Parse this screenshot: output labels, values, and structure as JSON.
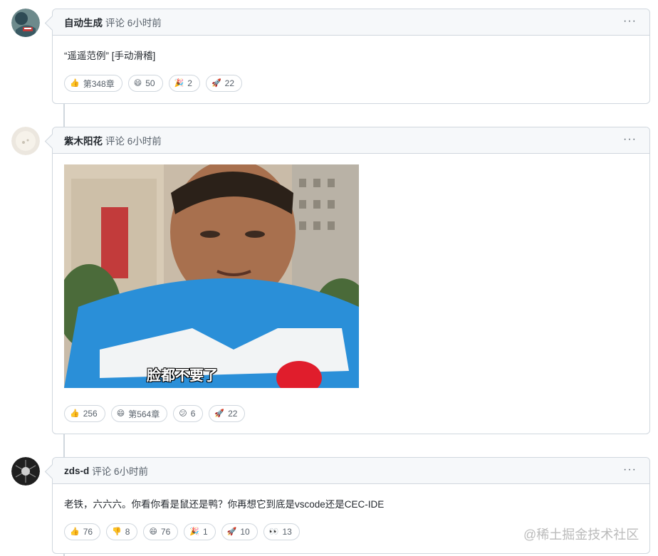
{
  "comments": [
    {
      "author": "自动生成",
      "meta": "评论 6小时前",
      "more": "···",
      "text": "“遥遥范例” [手动滑稽]",
      "reactions": [
        {
          "emoji": "👍",
          "count": "第348章"
        },
        {
          "emoji": "😄",
          "count": "50"
        },
        {
          "emoji": "🎉",
          "count": "2"
        },
        {
          "emoji": "🚀",
          "count": "22"
        }
      ]
    },
    {
      "author": "紫木阳花",
      "meta": "评论 6小时前",
      "more": "···",
      "image_caption": "脸都不要了",
      "reactions": [
        {
          "emoji": "👍",
          "count": "256"
        },
        {
          "emoji": "😄",
          "count": "第564章"
        },
        {
          "emoji": "😕",
          "count": "6"
        },
        {
          "emoji": "🚀",
          "count": "22"
        }
      ]
    },
    {
      "author": "zds-d",
      "meta": "评论 6小时前",
      "more": "···",
      "text": "老铁，六六六。你看你看是鼠还是鸭？你再想它到底是vscode还是CEC-IDE",
      "reactions": [
        {
          "emoji": "👍",
          "count": "76"
        },
        {
          "emoji": "👎",
          "count": "8"
        },
        {
          "emoji": "😄",
          "count": "76"
        },
        {
          "emoji": "🎉",
          "count": "1"
        },
        {
          "emoji": "🚀",
          "count": "10"
        },
        {
          "emoji": "👀",
          "count": "13"
        }
      ]
    }
  ],
  "watermark": "@稀土掘金技术社区",
  "colors": {
    "border": "#d0d7de",
    "header_bg": "#f6f8fa",
    "muted_text": "#57606a",
    "shirt_blue": "#2a8fd8"
  }
}
